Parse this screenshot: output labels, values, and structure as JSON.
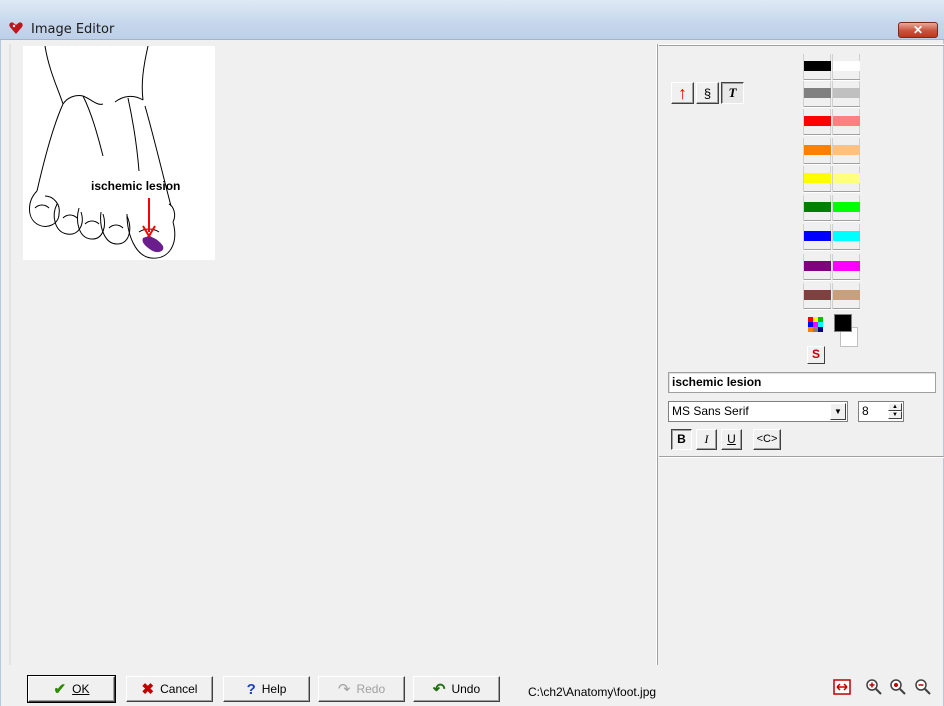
{
  "window": {
    "title": "Image Editor",
    "close_label": "✕"
  },
  "image": {
    "annotation_text": "ischemic lesion"
  },
  "tools": [
    {
      "name": "arrow",
      "glyph": "↑",
      "color": "#ff0000"
    },
    {
      "name": "freehand",
      "glyph": "§",
      "color": "#000000"
    },
    {
      "name": "text",
      "glyph": "T",
      "color": "#000000"
    }
  ],
  "palette": {
    "left": [
      "#000000",
      "#808080",
      "#ff0000",
      "#ff8000",
      "#ffff00",
      "#008000",
      "#0000ff",
      "#800080",
      "#804040"
    ],
    "right": [
      "#ffffff",
      "#c0c0c0",
      "#ff8080",
      "#ffc080",
      "#ffff80",
      "#00ff00",
      "#00ffff",
      "#ff00ff",
      "#c8a07c"
    ],
    "foreground": "#000000",
    "background": "#ffffff",
    "s_label": "S"
  },
  "text_tool": {
    "text_value": "ischemic lesion",
    "font_name": "MS Sans Serif",
    "font_size": "8",
    "bold_label": "B",
    "italic_label": "I",
    "underline_label": "U",
    "code_label": "<C>"
  },
  "buttons": {
    "ok": {
      "label": "OK",
      "icon": "checkmark-icon"
    },
    "cancel": {
      "label": "Cancel",
      "icon": "x-icon"
    },
    "help": {
      "label": "Help",
      "icon": "question-icon"
    },
    "redo": {
      "label": "Redo",
      "icon": "redo-icon"
    },
    "undo": {
      "label": "Undo",
      "icon": "undo-icon"
    }
  },
  "status": {
    "file_path": "C:\\ch2\\Anatomy\\foot.jpg"
  },
  "zoom_controls": [
    "fit-width-icon",
    "zoom-in-icon",
    "zoom-actual-icon",
    "zoom-out-icon"
  ]
}
